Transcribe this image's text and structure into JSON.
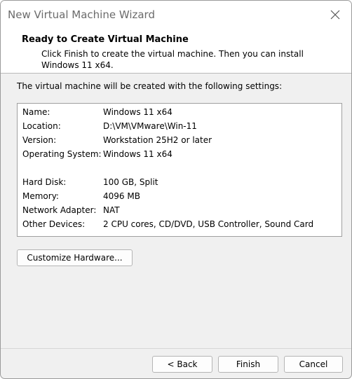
{
  "window": {
    "title": "New Virtual Machine Wizard"
  },
  "header": {
    "title": "Ready to Create Virtual Machine",
    "description": "Click Finish to create the virtual machine. Then you can install Windows 11 x64."
  },
  "intro": "The virtual machine will be created with the following settings:",
  "settings": [
    {
      "label": "Name:",
      "value": "Windows 11 x64"
    },
    {
      "label": "Location:",
      "value": "D:\\VM\\VMware\\Win-11"
    },
    {
      "label": "Version:",
      "value": "Workstation 25H2 or later"
    },
    {
      "label": "Operating System:",
      "value": "Windows 11 x64"
    },
    {
      "label": "Hard Disk:",
      "value": "100 GB, Split"
    },
    {
      "label": "Memory:",
      "value": "4096 MB"
    },
    {
      "label": "Network Adapter:",
      "value": "NAT"
    },
    {
      "label": "Other Devices:",
      "value": "2 CPU cores, CD/DVD, USB Controller, Sound Card"
    }
  ],
  "buttons": {
    "customize": "Customize Hardware...",
    "back": "< Back",
    "finish": "Finish",
    "cancel": "Cancel"
  },
  "icons": {
    "close": "close-icon"
  }
}
